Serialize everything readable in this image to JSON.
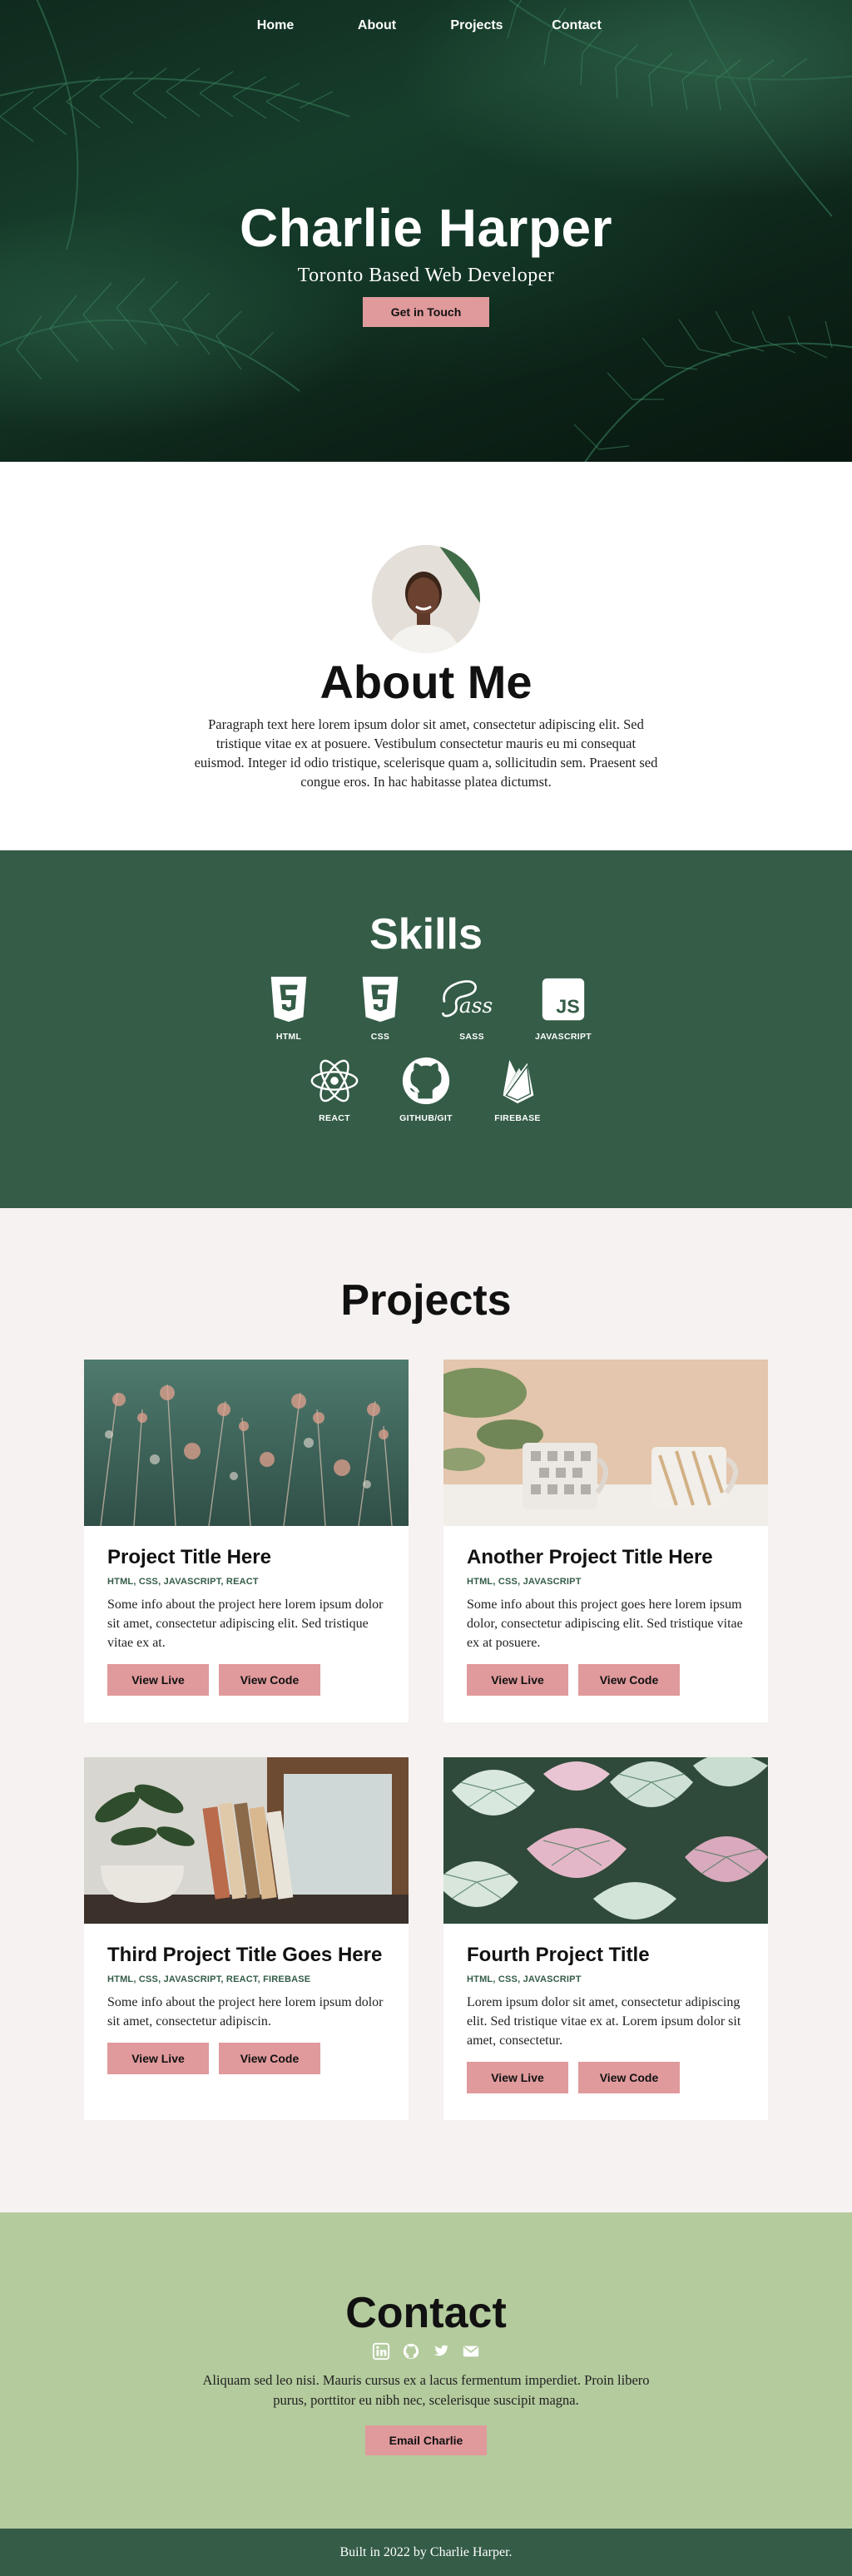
{
  "nav": {
    "items": [
      {
        "label": "Home"
      },
      {
        "label": "About"
      },
      {
        "label": "Projects"
      },
      {
        "label": "Contact"
      }
    ]
  },
  "hero": {
    "title": "Charlie Harper",
    "subtitle": "Toronto Based Web Developer",
    "button_label": "Get in Touch"
  },
  "about": {
    "title": "About Me",
    "text": "Paragraph text here lorem ipsum dolor sit amet, consectetur adipiscing elit. Sed tristique vitae ex at posuere. Vestibulum consectetur mauris eu mi consequat euismod. Integer id odio tristique, scelerisque quam a, sollicitudin sem. Praesent sed congue eros. In hac habitasse platea dictumst."
  },
  "skills": {
    "title": "Skills",
    "items": [
      {
        "label": "HTML",
        "icon": "html5-icon"
      },
      {
        "label": "CSS",
        "icon": "css3-icon"
      },
      {
        "label": "SASS",
        "icon": "sass-icon"
      },
      {
        "label": "JAVASCRIPT",
        "icon": "javascript-icon"
      },
      {
        "label": "REACT",
        "icon": "react-icon"
      },
      {
        "label": "GITHUB/GIT",
        "icon": "github-icon"
      },
      {
        "label": "FIREBASE",
        "icon": "firebase-icon"
      }
    ]
  },
  "projects": {
    "title": "Projects",
    "view_live_label": "View Live",
    "view_code_label": "View Code",
    "items": [
      {
        "title": "Project Title Here",
        "tags": "HTML, CSS, JAVASCRIPT, REACT",
        "text": "Some info about the project here lorem ipsum dolor sit amet, consectetur adipiscing elit. Sed tristique vitae ex at."
      },
      {
        "title": "Another Project Title Here",
        "tags": "HTML, CSS, JAVASCRIPT",
        "text": "Some info about this project goes here lorem ipsum dolor, consectetur adipiscing elit. Sed tristique vitae ex at posuere."
      },
      {
        "title": "Third Project Title Goes Here",
        "tags": "HTML, CSS, JAVASCRIPT, REACT, FIREBASE",
        "text": "Some info about the project here lorem ipsum dolor sit amet, consectetur adipiscin."
      },
      {
        "title": "Fourth Project Title",
        "tags": "HTML, CSS, JAVASCRIPT",
        "text": "Lorem ipsum dolor sit amet, consectetur adipiscing elit. Sed tristique vitae ex at. Lorem ipsum dolor sit amet, consectetur."
      }
    ]
  },
  "contact": {
    "title": "Contact",
    "text": "Aliquam sed leo nisi. Mauris cursus ex a lacus fermentum imperdiet. Proin libero purus, porttitor eu nibh nec, scelerisque suscipit magna.",
    "button_label": "Email Charlie",
    "social": [
      "linkedin-icon",
      "github-icon",
      "twitter-icon",
      "email-icon"
    ]
  },
  "footer": {
    "text": "Built in 2022 by Charlie Harper."
  },
  "colors": {
    "accent": "#e09a9c",
    "dark_green": "#345c47",
    "light_green": "#b4cb9d",
    "projects_bg": "#f6f2f1"
  }
}
